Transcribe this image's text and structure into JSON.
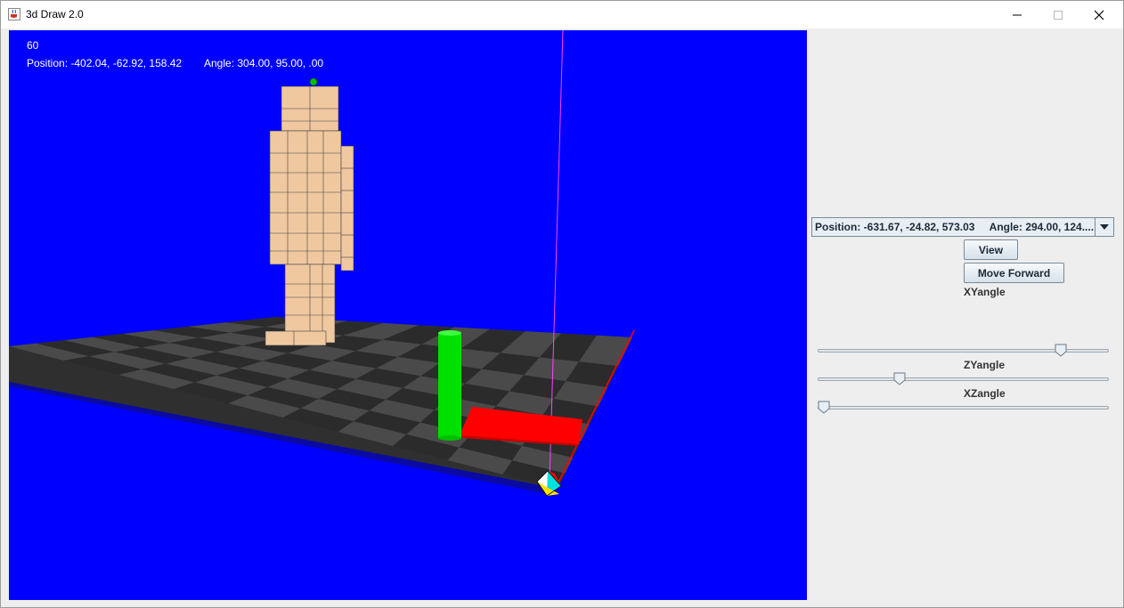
{
  "window": {
    "title": "3d Draw 2.0"
  },
  "hud": {
    "fps": "60",
    "position": "Position: -402.04, -62.92, 158.42",
    "angle": "Angle: 304.00, 95.00, .00"
  },
  "panel": {
    "view_selector_value": "Position: -631.67, -24.82, 573.03     Angle: 294.00, 124....",
    "view_button": "View",
    "move_forward_button": "Move Forward",
    "sliders": [
      {
        "label": "XYangle",
        "value_fraction": 0.85
      },
      {
        "label": "ZYangle",
        "value_fraction": 0.27
      },
      {
        "label": "XZangle",
        "value_fraction": 0.0
      }
    ]
  },
  "colors": {
    "viewport_bg": "#0000ff",
    "floor_dark": "#2b2b2b",
    "floor_light": "#4a4a4a",
    "figure_skin": "#f0c8a0",
    "cylinder": "#00e000",
    "box": "#ff0000",
    "axis_line": "#ff44ff"
  },
  "icons": {
    "app": "java-cup-icon",
    "minimize": "minimize-icon",
    "maximize": "maximize-icon",
    "close": "close-icon",
    "dropdown": "chevron-down-icon"
  }
}
